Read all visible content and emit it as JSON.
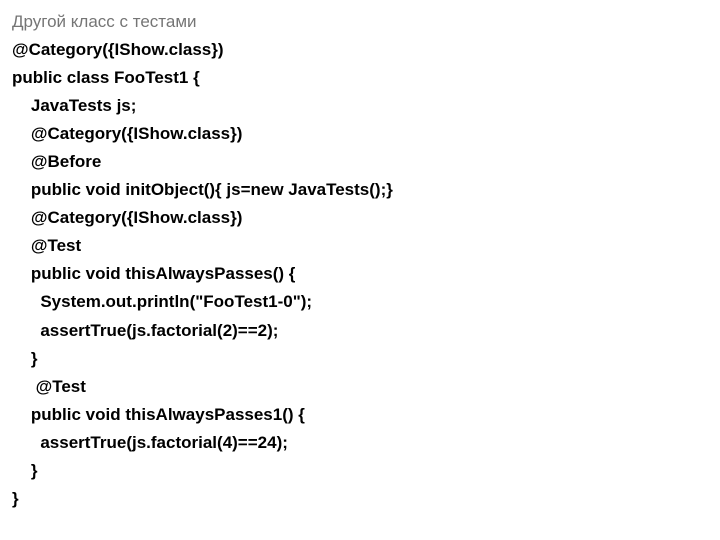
{
  "title": "Другой класс с тестами",
  "code": {
    "l01": "@Category({IShow.class})",
    "l02": "public class FooTest1 {",
    "l03": "    JavaTests js;",
    "l04": "    @Category({IShow.class})",
    "l05": "    @Before",
    "l06": "    public void initObject(){ js=new JavaTests();}",
    "l07": "    @Category({IShow.class})",
    "l08": "    @Test",
    "l09": "    public void thisAlwaysPasses() {",
    "l10": "      System.out.println(\"FooTest1-0\");",
    "l11": "      assertTrue(js.factorial(2)==2);",
    "l12": "    }",
    "l13": "     @Test",
    "l14": "    public void thisAlwaysPasses1() {",
    "l15": "      assertTrue(js.factorial(4)==24);",
    "l16": "    }",
    "l17": "}"
  }
}
